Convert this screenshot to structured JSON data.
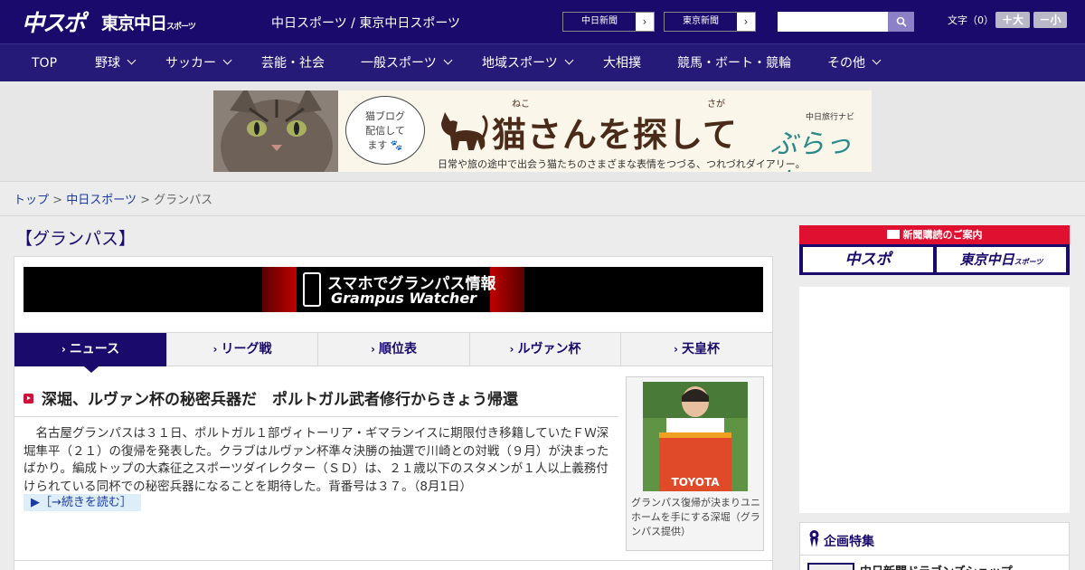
{
  "header": {
    "logo_chusupo": "中スポ",
    "logo_tokyo": "東京中日",
    "logo_tokyo_sub": "スポーツ",
    "site_title": "中日スポーツ / 東京中日スポーツ",
    "link_chunichi": "中日新聞",
    "link_tokyo": "東京新聞",
    "search_placeholder": "",
    "font_size_label": "文字（0）",
    "font_bigger": "＋大",
    "font_smaller": "－小"
  },
  "nav": {
    "items": [
      {
        "label": "TOP",
        "has_menu": false
      },
      {
        "label": "野球",
        "has_menu": true
      },
      {
        "label": "サッカー",
        "has_menu": true
      },
      {
        "label": "芸能・社会",
        "has_menu": false
      },
      {
        "label": "一般スポーツ",
        "has_menu": true
      },
      {
        "label": "地域スポーツ",
        "has_menu": true
      },
      {
        "label": "大相撲",
        "has_menu": false
      },
      {
        "label": "競馬・ボート・競輪",
        "has_menu": false
      },
      {
        "label": "その他",
        "has_menu": true
      }
    ]
  },
  "ad_banner": {
    "bubble": "猫ブログ\n配信して\nます",
    "ruby_1": "ねこ",
    "ruby_2": "さが",
    "headline": "猫さんを探して",
    "brand_sub": "中日旅行ナビ",
    "brand": "ぶらっ人",
    "tagline": "日常や旅の途中で出会う猫たちのさまざまな表情をつづる、つれづれダイアリー。"
  },
  "breadcrumb": {
    "items": [
      "トップ",
      "中日スポーツ"
    ],
    "separator": ">",
    "current": "グランパス"
  },
  "page_title": "【グランパス】",
  "grampus_banner": {
    "line1": "スマホでグランパス情報",
    "line2": "Grampus Watcher"
  },
  "tabs": [
    {
      "label": "ニュース",
      "active": true
    },
    {
      "label": "リーグ戦",
      "active": false
    },
    {
      "label": "順位表",
      "active": false
    },
    {
      "label": "ルヴァン杯",
      "active": false
    },
    {
      "label": "天皇杯",
      "active": false
    }
  ],
  "article": {
    "headline": "深堀、ルヴァン杯の秘密兵器だ　ポルトガル武者修行からきょう帰還",
    "body": "名古屋グランパスは３１日、ポルトガル１部ヴィトーリア・ギマランイスに期限付き移籍していたＦＷ深堀隼平（２１）の復帰を発表した。クラブはルヴァン杯準々決勝の抽選で川崎との対戦（９月）が決まったばかり。編成トップの大森征之スポーツダイレクター（ＳＤ）は、２１歳以下のスタメンが１人以上義務付けられている同杯での秘密兵器になることを期待した。背番号は３７。（8月1日）",
    "read_more": "▶［→続きを読む］",
    "photo_shirt_text": "TOYOTA",
    "photo_caption": "グランパス復帰が決まりユニホームを手にする深堀（グランパス提供）"
  },
  "sidebar": {
    "subscribe_title": "新聞購読のご案内",
    "subscribe_chusupo": "中スポ",
    "subscribe_tokyo": "東京中日",
    "subscribe_tokyo_sub": "スポーツ",
    "special_title": "企画特集",
    "special_item": "中日新聞ドラゴンズショップ"
  },
  "colors": {
    "brand_navy": "#1a0a6b",
    "nav_bg": "#251a78",
    "accent_red": "#e01030",
    "link_blue": "#1a3aa0"
  }
}
